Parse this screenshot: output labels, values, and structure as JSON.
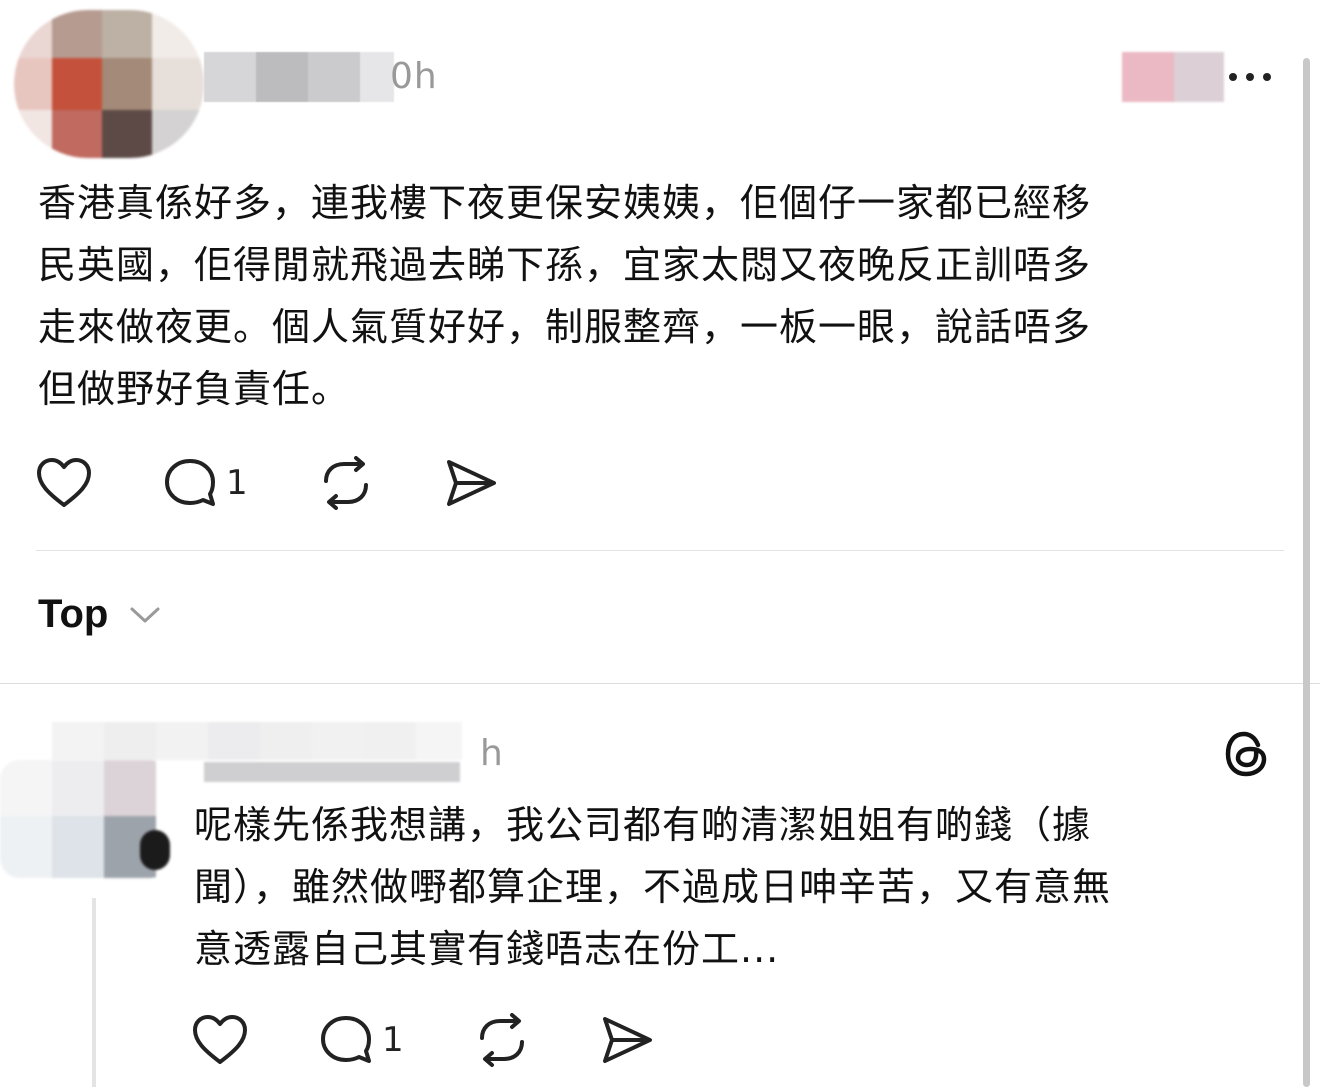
{
  "post": {
    "time": "0h",
    "text": "香港真係好多，連我樓下夜更保安姨姨，佢個仔一家都已經移\n民英國，佢得閒就飛過去睇下孫，宜家太悶又夜晚反正訓唔多\n走來做夜更。個人氣質好好，制服整齊，一板一眼，說話唔多\n但做野好負責任。",
    "reply_count": "1"
  },
  "sort": {
    "label": "Top"
  },
  "reply": {
    "time": "h",
    "text": "呢樣先係我想講，我公司都有啲清潔姐姐有啲錢（據\n聞），雖然做嘢都算企理，不過成日呻辛苦，又有意無\n意透露自己其實有錢唔志在份工...",
    "reply_count": "1"
  },
  "icons": {
    "like": "heart-icon",
    "comment": "comment-bubble-icon",
    "repost": "repost-icon",
    "share": "send-icon",
    "more": "more-icon",
    "sort_chevron": "chevron-down-icon",
    "threads": "threads-logo-icon"
  }
}
